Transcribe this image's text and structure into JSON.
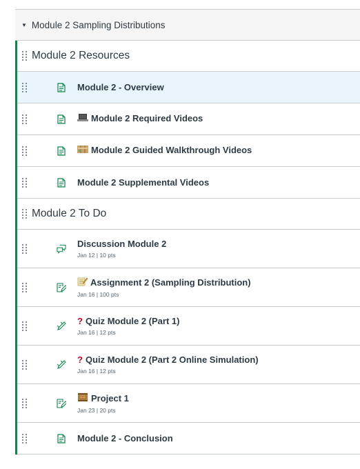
{
  "module": {
    "title": "Module 2 Sampling Distributions",
    "caret_icon": "caret-down-icon"
  },
  "sections": [
    {
      "header": "Module 2 Resources",
      "items": [
        {
          "title": "Module 2 - Overview",
          "icon": "page-icon",
          "selected": true
        },
        {
          "title": "Module 2 Required Videos",
          "icon": "page-icon",
          "emoji": "laptop"
        },
        {
          "title": "Module 2 Guided Walkthrough Videos",
          "icon": "page-icon",
          "emoji": "map"
        },
        {
          "title": "Module 2 Supplemental Videos",
          "icon": "page-icon"
        }
      ]
    },
    {
      "header": "Module 2 To Do",
      "items": [
        {
          "title": "Discussion Module 2",
          "meta": "Jan 12  |  10 pts",
          "icon": "discussion-icon"
        },
        {
          "title": "Assignment 2 (Sampling Distribution)",
          "meta": "Jan 16  |  100 pts",
          "icon": "assignment-icon",
          "emoji": "memo"
        },
        {
          "title": "Quiz Module 2 (Part 1)",
          "meta": "Jan 16  |  12 pts",
          "icon": "quiz-icon",
          "emoji": "question"
        },
        {
          "title": "Quiz Module 2 (Part 2 Online Simulation)",
          "meta": "Jan 16  |  12 pts",
          "icon": "quiz-icon",
          "emoji": "question"
        },
        {
          "title": "Project 1",
          "meta": "Jan 23  |  20 pts",
          "icon": "assignment-icon",
          "emoji": "scroll"
        },
        {
          "title": "Module 2 - Conclusion",
          "icon": "page-icon"
        }
      ]
    }
  ],
  "colors": {
    "accent_border": "#0b874b",
    "icon_green": "#0b874b",
    "text": "#2d3b45",
    "selected_bg": "#e9f4fb"
  }
}
